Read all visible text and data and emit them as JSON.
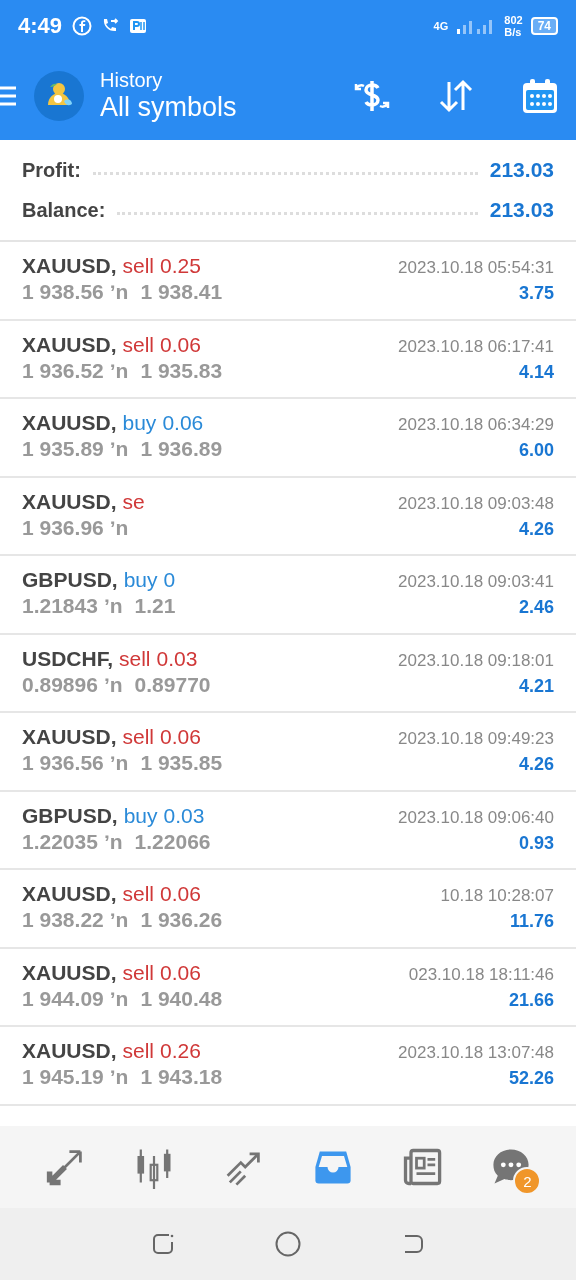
{
  "status_bar": {
    "time": "4:49",
    "network": "4G",
    "speed_value": "802",
    "speed_unit": "B/s",
    "battery": "74"
  },
  "header": {
    "subtitle": "History",
    "title": "All symbols"
  },
  "summary": [
    {
      "label": "Profit:",
      "value": "213.03"
    },
    {
      "label": "Balance:",
      "value": "213.03"
    }
  ],
  "trades": [
    {
      "symbol": "XAUUSD,",
      "kind": "sell",
      "side": "sell",
      "lot": "0.25",
      "open": "1 938.56",
      "arrow": "ʼn",
      "close": "1 938.41",
      "time": "2023.10.18 05:54:31",
      "profit": "3.75"
    },
    {
      "symbol": "XAUUSD,",
      "kind": "sell",
      "side": "sell",
      "lot": "0.06",
      "open": "1 936.52",
      "arrow": "ʼn",
      "close": "1 935.83",
      "time": "2023.10.18 06:17:41",
      "profit": "4.14"
    },
    {
      "symbol": "XAUUSD,",
      "kind": "buy",
      "side": "buy",
      "lot": "0.06",
      "open": "1 935.89",
      "arrow": "ʼn",
      "close": "1 936.89",
      "time": "2023.10.18 06:34:29",
      "profit": "6.00"
    },
    {
      "symbol": "XAUUSD,",
      "kind": "sell",
      "side": "se",
      "open": "1 936.96",
      "arrow": "ʼn",
      "time": "2023.10.18 09:03:48",
      "profit": "4.26"
    },
    {
      "symbol": "GBPUSD,",
      "kind": "buy",
      "side": "buy",
      "lot": "0",
      "open": "1.21843",
      "arrow": "ʼn",
      "close": "1.21",
      "time": "2023.10.18 09:03:41",
      "profit": "2.46"
    },
    {
      "symbol": "USDCHF,",
      "kind": "sell",
      "side": "sell",
      "lot": "0.03",
      "open": "0.89896",
      "arrow": "ʼn",
      "close": "0.89770",
      "time": "2023.10.18 09:18:01",
      "profit": "4.21"
    },
    {
      "symbol": "XAUUSD,",
      "kind": "sell",
      "side": "sell",
      "lot": "0.06",
      "open": "1 936.56",
      "arrow": "ʼn",
      "close": "1 935.85",
      "time": "2023.10.18 09:49:23",
      "profit": "4.26"
    },
    {
      "symbol": "GBPUSD,",
      "kind": "buy",
      "side": "buy",
      "lot": "0.03",
      "open": "1.22035",
      "arrow": "ʼn",
      "close": "1.22066",
      "time": "2023.10.18 09:06:40",
      "profit": "0.93"
    },
    {
      "symbol": "XAUUSD,",
      "kind": "sell",
      "side": "sell",
      "lot": "0.06",
      "open": "1 938.22",
      "arrow": "ʼn",
      "close": "1 936.26",
      "time": "10.18 10:28:07",
      "profit": "11.76"
    },
    {
      "symbol": "XAUUSD,",
      "kind": "sell",
      "side": "sell",
      "lot": "0.06",
      "open": "1 944.09",
      "arrow": "ʼn",
      "close": "1 940.48",
      "time": "023.10.18 18:11:46",
      "profit": "21.66"
    },
    {
      "symbol": "XAUUSD,",
      "kind": "sell",
      "side": "sell",
      "lot": "0.26",
      "open": "1 945.19",
      "arrow": "ʼn",
      "close": "1 943.18",
      "time": "2023.10.18 13:07:48",
      "profit": "52.26"
    }
  ],
  "bottom_nav": [
    {
      "kind": "quotes",
      "selected": false
    },
    {
      "kind": "chart",
      "selected": false
    },
    {
      "kind": "trade",
      "selected": false
    },
    {
      "kind": "history",
      "selected": true
    },
    {
      "kind": "news",
      "selected": false
    },
    {
      "kind": "messages",
      "selected": false,
      "badge": "2"
    }
  ]
}
